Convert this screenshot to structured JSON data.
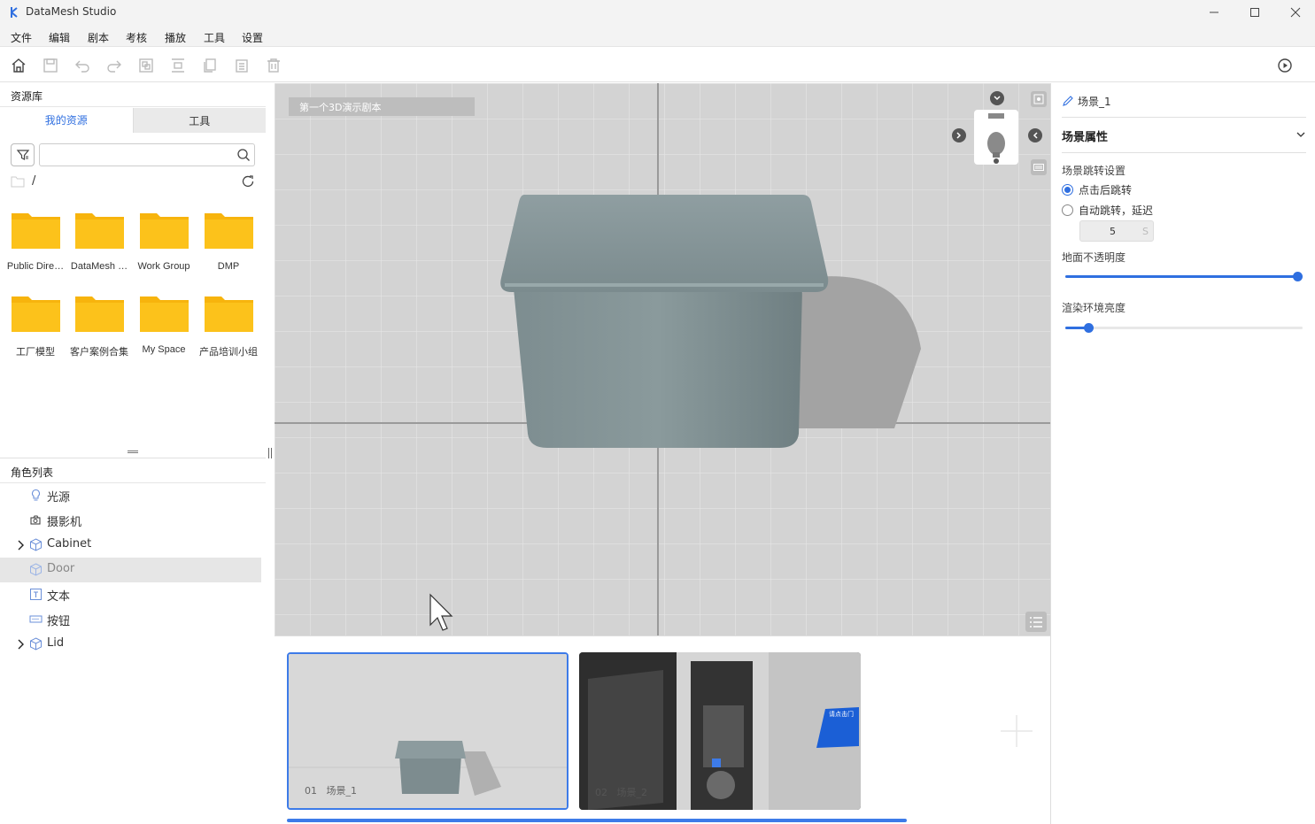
{
  "app": {
    "title": "DataMesh Studio",
    "accent_color": "#2f6fe0"
  },
  "window_controls": [
    "minimize-icon",
    "maximize-icon",
    "close-icon"
  ],
  "menu": {
    "items": [
      "文件",
      "编辑",
      "剧本",
      "考核",
      "播放",
      "工具",
      "设置"
    ]
  },
  "toolbar": {
    "icons": [
      "home-icon",
      "save-icon",
      "undo-icon",
      "redo-icon",
      "group-icon",
      "align-icon",
      "copy-icon",
      "paste-icon",
      "delete-icon",
      "play-icon"
    ]
  },
  "resource_panel": {
    "header": "资源库",
    "tabs": [
      "我的资源",
      "工具"
    ],
    "active_tab": "我的资源",
    "search": {
      "value": "",
      "placeholder": ""
    },
    "path": "/",
    "folders": [
      {
        "name": "Public Dire…"
      },
      {
        "name": "DataMesh …"
      },
      {
        "name": "Work Group"
      },
      {
        "name": "DMP"
      },
      {
        "name": "工厂模型"
      },
      {
        "name": "客户案例合集"
      },
      {
        "name": "My Space"
      },
      {
        "name": "产品培训小组"
      }
    ]
  },
  "role_panel": {
    "header": "角色列表",
    "items": [
      {
        "label": "光源",
        "icon": "lightbulb-icon",
        "expandable": false,
        "selected": false
      },
      {
        "label": "摄影机",
        "icon": "camera-icon",
        "expandable": false,
        "selected": false
      },
      {
        "label": "Cabinet",
        "icon": "cube-icon",
        "expandable": true,
        "selected": false
      },
      {
        "label": "Door",
        "icon": "cube-icon",
        "expandable": false,
        "selected": true
      },
      {
        "label": "文本",
        "icon": "text-icon",
        "expandable": false,
        "selected": false
      },
      {
        "label": "按钮",
        "icon": "button-icon",
        "expandable": false,
        "selected": false
      },
      {
        "label": "Lid",
        "icon": "cube-icon",
        "expandable": true,
        "selected": false
      }
    ]
  },
  "viewport": {
    "script_name": "第一个3D演示剧本"
  },
  "scenes": {
    "items": [
      {
        "index": "01",
        "name": "场景_1",
        "selected": true
      },
      {
        "index": "02",
        "name": "场景_2",
        "selected": false
      }
    ],
    "scene2_sign_text": "请点击门",
    "add_icon": "plus-icon"
  },
  "properties": {
    "scene_name": "场景_1",
    "section_title": "场景属性",
    "jump_settings_label": "场景跳转设置",
    "radio_click": "点击后跳转",
    "radio_auto": "自动跳转，延迟",
    "selected_radio": "点击后跳转",
    "delay_value": "5",
    "delay_unit": "S",
    "ground_opacity_label": "地面不透明度",
    "ground_opacity_value": 1.0,
    "env_brightness_label": "渲染环境亮度",
    "env_brightness_value": 0.08
  }
}
